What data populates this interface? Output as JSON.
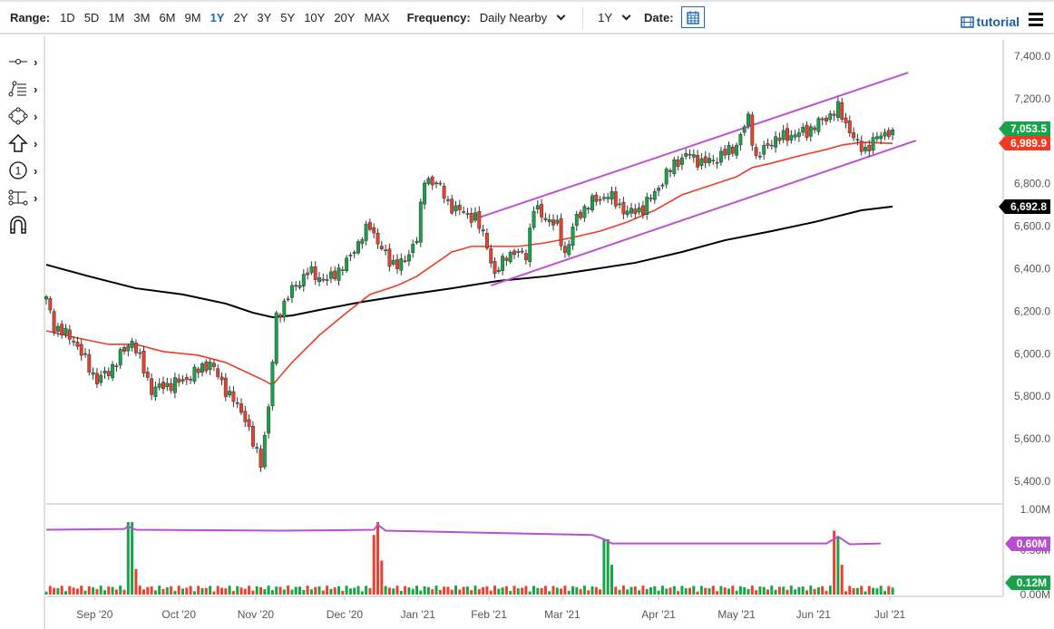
{
  "toolbar": {
    "range_label": "Range:",
    "ranges": [
      "1D",
      "5D",
      "1M",
      "3M",
      "6M",
      "9M",
      "1Y",
      "2Y",
      "3Y",
      "5Y",
      "10Y",
      "20Y",
      "MAX"
    ],
    "active_range": "1Y",
    "frequency_label": "Frequency:",
    "frequency_value": "Daily Nearby",
    "period_value": "1Y",
    "date_label": "Date:",
    "tutorial_label": "tutorial"
  },
  "left_tools": [
    "line-tool",
    "fibonacci-tool",
    "shape-tool",
    "arrow-tool",
    "annotation-tool",
    "measure-tool",
    "magnet-tool"
  ],
  "colors": {
    "up": "#18a34a",
    "down": "#e8412c",
    "ma50": "#ef3b24",
    "ma200": "#000000",
    "channel": "#c04fd6",
    "oi": "#b84fd0",
    "accent": "#1a6bbf"
  },
  "chart_data": {
    "type": "candlestick",
    "x_unit": "trading-day index",
    "xlim": [
      0,
      244
    ],
    "ylim": [
      5400,
      7500
    ],
    "y_ticks": [
      "7,400.0",
      "7,200.0",
      "7,000.0",
      "6,800.0",
      "6,600.0",
      "6,400.0",
      "6,200.0",
      "6,000.0",
      "5,800.0",
      "5,600.0",
      "5,400.0"
    ],
    "y_tick_values": [
      7400,
      7200,
      7000,
      6800,
      6600,
      6400,
      6200,
      6000,
      5800,
      5600,
      5400
    ],
    "x_ticks": [
      {
        "label": "Sep '20",
        "i": 12.4
      },
      {
        "label": "Oct '20",
        "i": 34
      },
      {
        "label": "Nov '20",
        "i": 53.7
      },
      {
        "label": "Dec '20",
        "i": 76.5
      },
      {
        "label": "Jan '21",
        "i": 95.3
      },
      {
        "label": "Feb '21",
        "i": 113.5
      },
      {
        "label": "Mar '21",
        "i": 132.3
      },
      {
        "label": "Apr '21",
        "i": 157
      },
      {
        "label": "May '21",
        "i": 177
      },
      {
        "label": "Jun '21",
        "i": 196.7
      },
      {
        "label": "Jul '21",
        "i": 216.3
      }
    ],
    "close_path": [
      [
        0,
        6257
      ],
      [
        2,
        6129
      ],
      [
        7,
        6065
      ],
      [
        13,
        5873
      ],
      [
        16,
        5916
      ],
      [
        22,
        6065
      ],
      [
        27,
        5831
      ],
      [
        35,
        5873
      ],
      [
        42,
        5959
      ],
      [
        46,
        5831
      ],
      [
        51,
        5703
      ],
      [
        53,
        5575
      ],
      [
        55,
        5490
      ],
      [
        57,
        5746
      ],
      [
        59,
        6172
      ],
      [
        63,
        6300
      ],
      [
        67,
        6385
      ],
      [
        72,
        6343
      ],
      [
        77,
        6428
      ],
      [
        81,
        6556
      ],
      [
        83,
        6598
      ],
      [
        88,
        6428
      ],
      [
        92,
        6428
      ],
      [
        95,
        6556
      ],
      [
        97,
        6812
      ],
      [
        100,
        6812
      ],
      [
        103,
        6705
      ],
      [
        107,
        6662
      ],
      [
        110,
        6641
      ],
      [
        113,
        6513
      ],
      [
        115,
        6364
      ],
      [
        118,
        6470
      ],
      [
        123,
        6470
      ],
      [
        125,
        6684
      ],
      [
        128,
        6641
      ],
      [
        131,
        6598
      ],
      [
        133,
        6470
      ],
      [
        136,
        6641
      ],
      [
        139,
        6705
      ],
      [
        144,
        6748
      ],
      [
        149,
        6662
      ],
      [
        153,
        6684
      ],
      [
        158,
        6812
      ],
      [
        161,
        6897
      ],
      [
        165,
        6939
      ],
      [
        168,
        6897
      ],
      [
        172,
        6918
      ],
      [
        177,
        6982
      ],
      [
        180,
        7110
      ],
      [
        182,
        6918
      ],
      [
        186,
        7003
      ],
      [
        190,
        7025
      ],
      [
        195,
        7046
      ],
      [
        200,
        7110
      ],
      [
        203,
        7153
      ],
      [
        208,
        6982
      ],
      [
        210,
        6961
      ],
      [
        214,
        7033
      ],
      [
        217,
        7053.5
      ]
    ],
    "ma50": [
      [
        0,
        6108
      ],
      [
        7,
        6078
      ],
      [
        16,
        6044
      ],
      [
        23,
        6044
      ],
      [
        30,
        6010
      ],
      [
        39,
        5993
      ],
      [
        46,
        5959
      ],
      [
        51,
        5916
      ],
      [
        56,
        5873
      ],
      [
        58,
        5852
      ],
      [
        63,
        5959
      ],
      [
        70,
        6087
      ],
      [
        77,
        6193
      ],
      [
        83,
        6279
      ],
      [
        90,
        6321
      ],
      [
        95,
        6364
      ],
      [
        100,
        6428
      ],
      [
        104,
        6479
      ],
      [
        109,
        6505
      ],
      [
        114,
        6505
      ],
      [
        121,
        6505
      ],
      [
        128,
        6522
      ],
      [
        135,
        6547
      ],
      [
        142,
        6577
      ],
      [
        149,
        6620
      ],
      [
        156,
        6675
      ],
      [
        163,
        6748
      ],
      [
        170,
        6790
      ],
      [
        177,
        6833
      ],
      [
        181,
        6876
      ],
      [
        186,
        6897
      ],
      [
        193,
        6931
      ],
      [
        200,
        6961
      ],
      [
        204,
        6982
      ],
      [
        209,
        6995
      ],
      [
        217,
        6989.9
      ]
    ],
    "ma200": [
      [
        0,
        6419
      ],
      [
        11,
        6364
      ],
      [
        23,
        6308
      ],
      [
        35,
        6279
      ],
      [
        46,
        6236
      ],
      [
        53,
        6193
      ],
      [
        58,
        6172
      ],
      [
        63,
        6180
      ],
      [
        70,
        6206
      ],
      [
        81,
        6244
      ],
      [
        93,
        6279
      ],
      [
        104,
        6308
      ],
      [
        116,
        6343
      ],
      [
        128,
        6364
      ],
      [
        139,
        6394
      ],
      [
        151,
        6428
      ],
      [
        163,
        6479
      ],
      [
        174,
        6534
      ],
      [
        186,
        6577
      ],
      [
        197,
        6620
      ],
      [
        209,
        6675
      ],
      [
        217,
        6692.8
      ]
    ],
    "channel_upper": [
      [
        111,
        6641
      ],
      [
        221,
        7323
      ]
    ],
    "channel_lower": [
      [
        114,
        6321
      ],
      [
        223,
        7003
      ]
    ],
    "last_labels": {
      "close": "7,053.5",
      "ma50": "6,989.9",
      "ma200": "6,692.8"
    },
    "volume": {
      "y_ticks": [
        "1.00M",
        "0.50M",
        "0.00M"
      ],
      "ylim": [
        0,
        1
      ],
      "baseline": 0.07,
      "spikes": [
        [
          21,
          0.85
        ],
        [
          22,
          0.85
        ],
        [
          23,
          0.3
        ],
        [
          84,
          0.7
        ],
        [
          85,
          0.85
        ],
        [
          86,
          0.4
        ],
        [
          143,
          0.65
        ],
        [
          144,
          0.65
        ],
        [
          145,
          0.35
        ],
        [
          202,
          0.75
        ],
        [
          203,
          0.68
        ],
        [
          204,
          0.35
        ]
      ],
      "open_interest": [
        [
          0,
          0.76
        ],
        [
          20,
          0.77
        ],
        [
          21,
          0.8
        ],
        [
          23,
          0.76
        ],
        [
          60,
          0.75
        ],
        [
          84,
          0.76
        ],
        [
          85,
          0.82
        ],
        [
          87,
          0.75
        ],
        [
          140,
          0.7
        ],
        [
          143,
          0.65
        ],
        [
          145,
          0.6
        ],
        [
          150,
          0.6
        ],
        [
          200,
          0.6
        ],
        [
          203,
          0.68
        ],
        [
          206,
          0.59
        ],
        [
          214,
          0.6
        ]
      ],
      "last_labels": {
        "oi": "0.60M",
        "volume": "0.12M"
      }
    }
  }
}
